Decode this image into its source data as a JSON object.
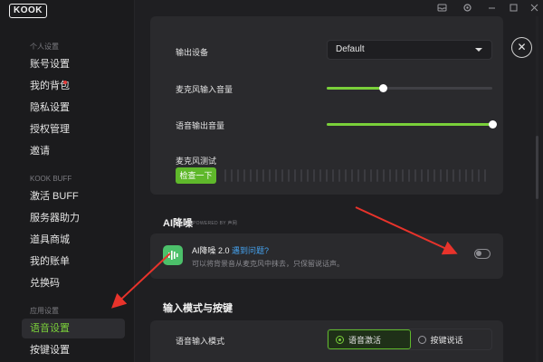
{
  "app": {
    "logo": "KOOK"
  },
  "sidebar": {
    "sections": [
      {
        "title": "个人设置",
        "items": [
          "账号设置",
          "我的背包",
          "隐私设置",
          "授权管理",
          "邀请"
        ]
      },
      {
        "title": "KOOK BUFF",
        "items": [
          "激活 BUFF",
          "服务器助力",
          "道具商城",
          "我的账单",
          "兑换码"
        ]
      },
      {
        "title": "应用设置",
        "items": [
          "语音设置",
          "按键设置"
        ]
      }
    ],
    "active_item": "语音设置"
  },
  "voice": {
    "output_device_label": "输出设备",
    "output_device_value": "Default",
    "mic_volume_label": "麦克风输入音量",
    "mic_volume": 0.34,
    "output_volume_label": "语音输出音量",
    "output_volume": 1.0,
    "mic_test_label": "麦克风测试",
    "mic_test_button": "检查一下"
  },
  "ai_noise": {
    "section_title": "AI降噪",
    "powered_by": "POWERED BY 声网",
    "title": "AI降噪 2.0",
    "link": "遇到问题?",
    "description": "可以将背景音从麦克风中抹去，只保留说话声。",
    "enabled": false
  },
  "input_mode": {
    "section_title": "输入模式与按键",
    "label": "语音输入模式",
    "options": [
      "语音激活",
      "按键说话"
    ],
    "selected": "语音激活"
  },
  "colors": {
    "accent": "#7ad03a",
    "link": "#45a3f0",
    "annotation": "#e8332b"
  },
  "icons": {
    "window": [
      "inbox-icon",
      "gear-icon",
      "minimize-icon",
      "maximize-icon",
      "close-icon"
    ]
  }
}
